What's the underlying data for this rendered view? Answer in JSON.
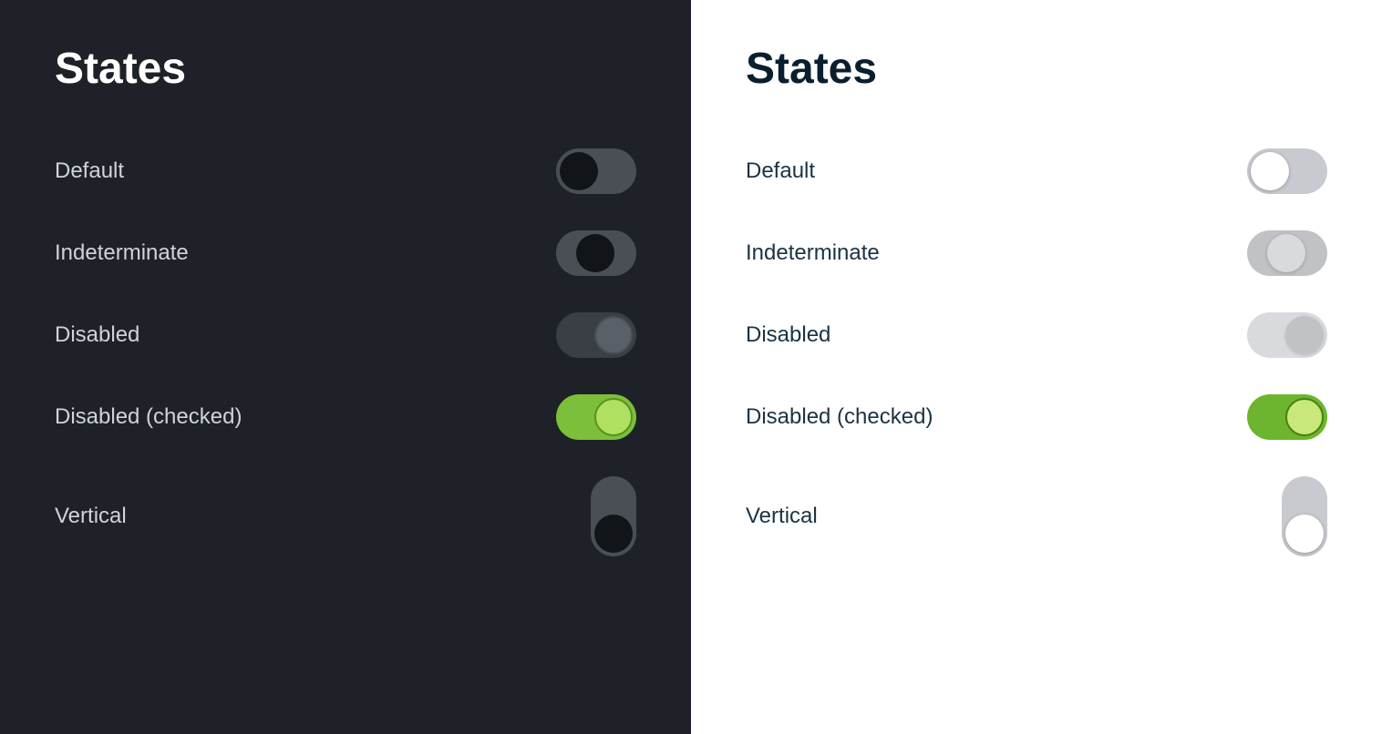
{
  "dark_panel": {
    "title": "States",
    "states": [
      {
        "label": "Default",
        "toggle_type": "toggle-default-dark",
        "orientation": "h"
      },
      {
        "label": "Indeterminate",
        "toggle_type": "toggle-indeterminate-dark",
        "orientation": "h"
      },
      {
        "label": "Disabled",
        "toggle_type": "toggle-disabled-dark",
        "orientation": "h"
      },
      {
        "label": "Disabled (checked)",
        "toggle_type": "toggle-disabled-checked-dark",
        "orientation": "h"
      },
      {
        "label": "Vertical",
        "toggle_type": "toggle-vertical-dark",
        "orientation": "v"
      }
    ]
  },
  "light_panel": {
    "title": "States",
    "states": [
      {
        "label": "Default",
        "toggle_type": "toggle-default-light",
        "orientation": "h"
      },
      {
        "label": "Indeterminate",
        "toggle_type": "toggle-indeterminate-light",
        "orientation": "h"
      },
      {
        "label": "Disabled",
        "toggle_type": "toggle-disabled-light",
        "orientation": "h"
      },
      {
        "label": "Disabled (checked)",
        "toggle_type": "toggle-disabled-checked-light",
        "orientation": "h"
      },
      {
        "label": "Vertical",
        "toggle_type": "toggle-vertical-light",
        "orientation": "v"
      }
    ]
  }
}
